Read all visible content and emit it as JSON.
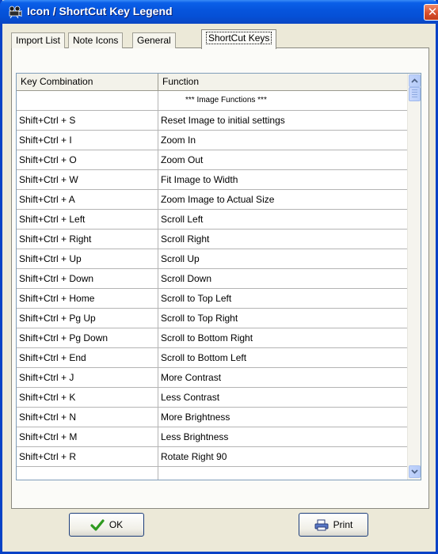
{
  "window": {
    "title": "Icon / ShortCut Key Legend",
    "close_glyph": "✕",
    "icon": "film-projector-icon"
  },
  "tabs": [
    {
      "label": "Import List",
      "active": false
    },
    {
      "label": "Note Icons",
      "active": false
    },
    {
      "label": "General",
      "active": false
    },
    {
      "label": "ShortCut Keys",
      "active": true
    }
  ],
  "grid": {
    "columns": [
      "Key Combination",
      "Function"
    ],
    "rows": [
      {
        "key": "",
        "function": "*** Image Functions ***"
      },
      {
        "key": "Shift+Ctrl + S",
        "function": "Reset Image to initial settings"
      },
      {
        "key": "Shift+Ctrl + I",
        "function": "Zoom In"
      },
      {
        "key": "Shift+Ctrl + O",
        "function": "Zoom Out"
      },
      {
        "key": "Shift+Ctrl + W",
        "function": "Fit Image to Width"
      },
      {
        "key": "Shift+Ctrl + A",
        "function": "Zoom Image to Actual Size"
      },
      {
        "key": "Shift+Ctrl + Left",
        "function": "Scroll Left"
      },
      {
        "key": "Shift+Ctrl + Right",
        "function": "Scroll Right"
      },
      {
        "key": "Shift+Ctrl + Up",
        "function": "Scroll Up"
      },
      {
        "key": "Shift+Ctrl + Down",
        "function": "Scroll Down"
      },
      {
        "key": "Shift+Ctrl + Home",
        "function": "Scroll to Top Left"
      },
      {
        "key": "Shift+Ctrl + Pg Up",
        "function": "Scroll to Top Right"
      },
      {
        "key": "Shift+Ctrl + Pg Down",
        "function": "Scroll to Bottom Right"
      },
      {
        "key": "Shift+Ctrl + End",
        "function": "Scroll to Bottom Left"
      },
      {
        "key": "Shift+Ctrl + J",
        "function": "More Contrast"
      },
      {
        "key": "Shift+Ctrl + K",
        "function": "Less Contrast"
      },
      {
        "key": "Shift+Ctrl + N",
        "function": "More Brightness"
      },
      {
        "key": "Shift+Ctrl + M",
        "function": "Less Brightness"
      },
      {
        "key": "Shift+Ctrl + R",
        "function": "Rotate Right 90"
      },
      {
        "key": "",
        "function": ""
      }
    ]
  },
  "buttons": {
    "ok_label": "OK",
    "print_label": "Print"
  },
  "colors": {
    "titlebar": "#0654dc",
    "window_bg": "#ece9d8",
    "grid_border": "#7f9db9",
    "ok_check": "#2e9a1e"
  }
}
